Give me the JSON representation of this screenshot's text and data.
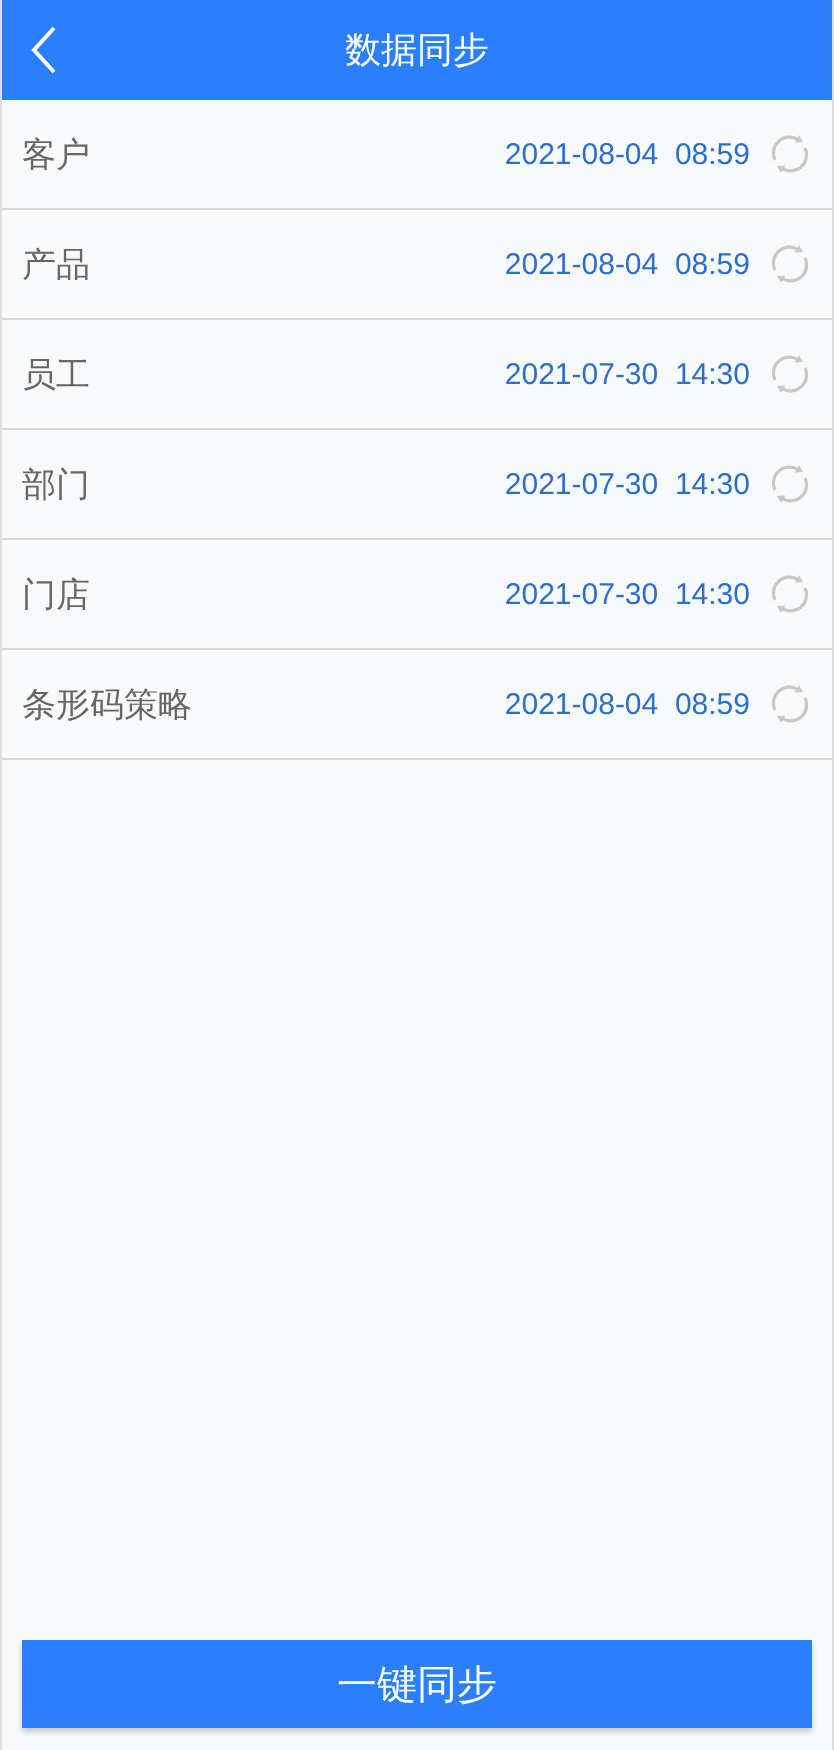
{
  "header": {
    "title": "数据同步"
  },
  "items": [
    {
      "name": "客户",
      "time": "2021-08-04  08:59"
    },
    {
      "name": "产品",
      "time": "2021-08-04  08:59"
    },
    {
      "name": "员工",
      "time": "2021-07-30  14:30"
    },
    {
      "name": "部门",
      "time": "2021-07-30  14:30"
    },
    {
      "name": "门店",
      "time": "2021-07-30  14:30"
    },
    {
      "name": "条形码策略",
      "time": "2021-08-04  08:59"
    }
  ],
  "button": "一键同步"
}
